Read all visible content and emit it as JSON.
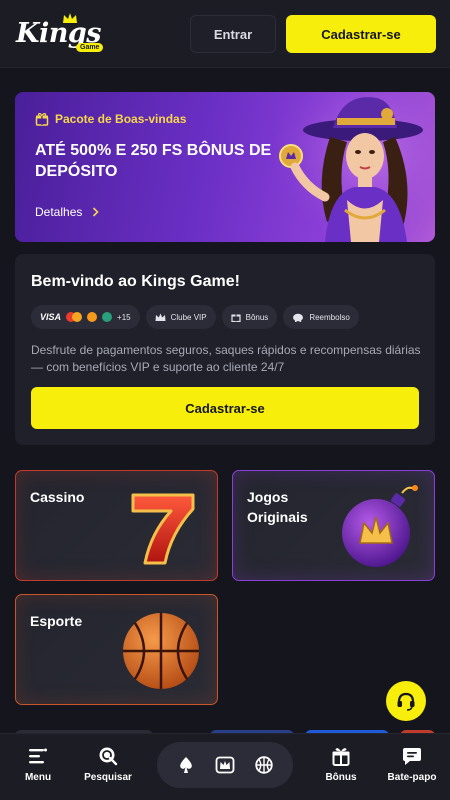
{
  "header": {
    "logo_text": "Kings",
    "logo_sub": "Game",
    "login_label": "Entrar",
    "signup_label": "Cadastrar-se"
  },
  "banner": {
    "chip_label": "Pacote de Boas-vindas",
    "title": "ATÉ 500% E 250 FS BÔNUS DE DEPÓSITO",
    "details_label": "Detalhes"
  },
  "welcome": {
    "title": "Bem-vindo ao Kings Game!",
    "payments": {
      "visa": "VISA",
      "more": "+15"
    },
    "pills": [
      "Clube VIP",
      "Bônus",
      "Reembolso"
    ],
    "description": "Desfrute de pagamentos seguros, saques rápidos e recompensas diárias — com benefícios VIP e suporte ao cliente 24/7",
    "button_label": "Cadastrar-se"
  },
  "tiles": [
    {
      "label": "Cassino"
    },
    {
      "label": "Jogos Originais"
    },
    {
      "label": "Esporte"
    }
  ],
  "bottom_nav": {
    "menu": "Menu",
    "search": "Pesquisar",
    "bonus": "Bônus",
    "chat": "Bate-papo"
  },
  "colors": {
    "accent": "#f7ee0c",
    "background": "#15161d",
    "card": "#1f2029",
    "banner_purple": "#6a2fc4"
  }
}
